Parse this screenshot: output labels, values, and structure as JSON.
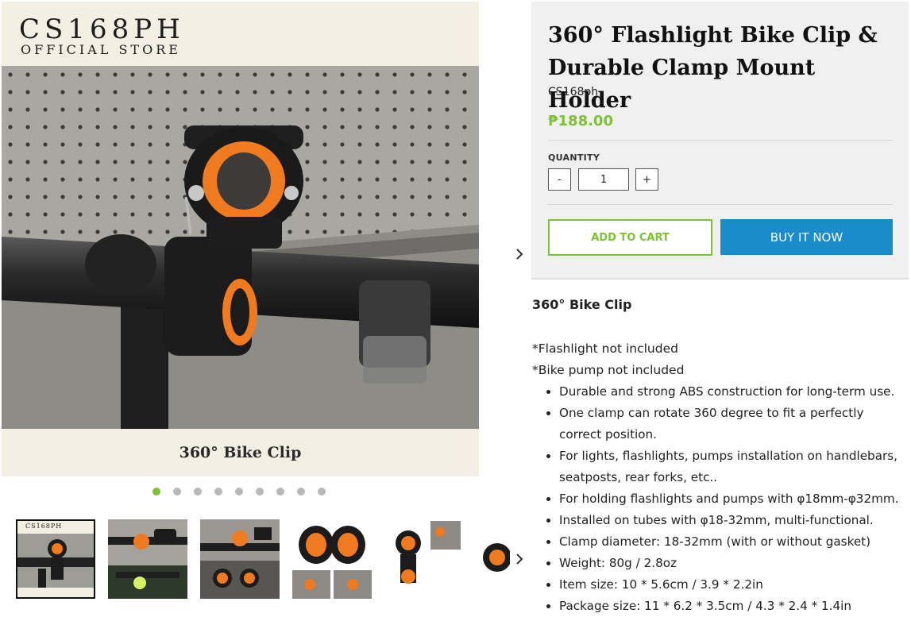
{
  "gallery": {
    "brand_title": "CS168PH",
    "brand_subtitle": "OFFICIAL STORE",
    "caption": "360° Bike Clip",
    "dot_count": 9,
    "active_dot": 0,
    "thumb_brand": "CS168PH"
  },
  "product": {
    "title": "360° Flashlight Bike Clip & Durable Clamp Mount Holder",
    "vendor": "CS168ph",
    "price": "₱188.00",
    "quantity_label": "QUANTITY",
    "quantity_value": "1",
    "minus_label": "-",
    "plus_label": "+",
    "add_to_cart": "ADD TO CART",
    "buy_now": "BUY IT NOW"
  },
  "description": {
    "heading": "360° Bike Clip",
    "note1": "*Flashlight not included",
    "note2": "*Bike pump not included",
    "bullets": [
      "Durable and strong ABS construction for long-term use.",
      "One clamp can rotate 360 degree to fit a perfectly correct position.",
      "For lights, flashlights, pumps installation on handlebars, seatposts, rear forks, etc..",
      "For holding flashlights and pumps with φ18mm-φ32mm.",
      "Installed on tubes with φ18-32mm, multi-functional.",
      "Clamp diameter: 18-32mm (with or without gasket)",
      "Weight: 80g / 2.8oz",
      "Item size: 10 * 5.6cm / 3.9 * 2.2in",
      "Package size: 11 * 6.2 * 3.5cm / 4.3 * 2.4 * 1.4in"
    ]
  },
  "colors": {
    "accent_green": "#7cc234",
    "buy_blue": "#1a8ccc",
    "clamp_orange": "#f07a1f"
  }
}
